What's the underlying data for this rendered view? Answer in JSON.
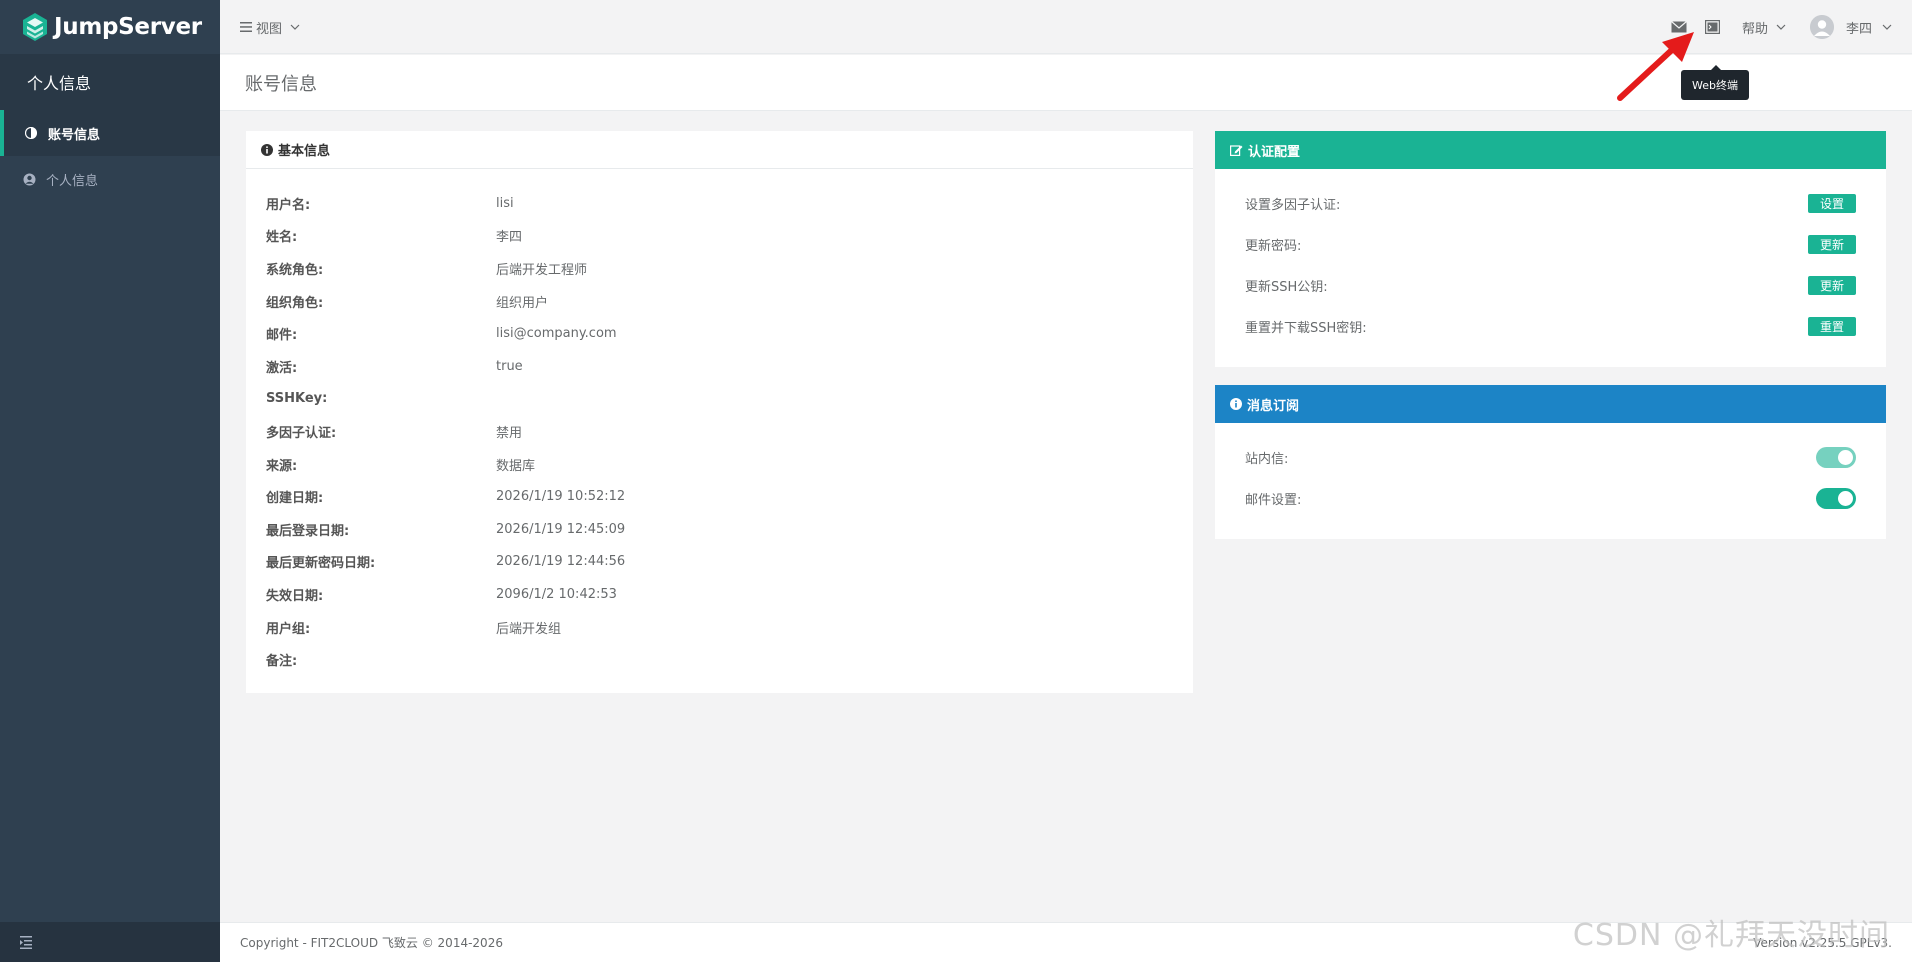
{
  "brand": {
    "name": "JumpServer"
  },
  "sidebar": {
    "header": "个人信息",
    "items": [
      {
        "label": "账号信息",
        "icon": "half-circle-icon",
        "active": true
      },
      {
        "label": "个人信息",
        "icon": "user-circle-icon",
        "active": false
      }
    ]
  },
  "topbar": {
    "view_menu": "视图",
    "help": "帮助",
    "user": "李四",
    "tooltip": "Web终端"
  },
  "page": {
    "title": "账号信息"
  },
  "basic_info": {
    "title": "基本信息",
    "rows": [
      {
        "label": "用户名:",
        "value": "lisi"
      },
      {
        "label": "姓名:",
        "value": "李四"
      },
      {
        "label": "系统角色:",
        "value": "后端开发工程师"
      },
      {
        "label": "组织角色:",
        "value": "组织用户"
      },
      {
        "label": "邮件:",
        "value": "lisi@company.com"
      },
      {
        "label": "激活:",
        "value": "true"
      },
      {
        "label": "SSHKey:",
        "value": ""
      },
      {
        "label": "多因子认证:",
        "value": "禁用"
      },
      {
        "label": "来源:",
        "value": "数据库"
      },
      {
        "label": "创建日期:",
        "value": "2026/1/19 10:52:12"
      },
      {
        "label": "最后登录日期:",
        "value": "2026/1/19 12:45:09"
      },
      {
        "label": "最后更新密码日期:",
        "value": "2026/1/19 12:44:56"
      },
      {
        "label": "失效日期:",
        "value": "2096/1/2 10:42:53"
      },
      {
        "label": "用户组:",
        "value": "后端开发组"
      },
      {
        "label": "备注:",
        "value": ""
      }
    ]
  },
  "auth_config": {
    "title": "认证配置",
    "items": [
      {
        "label": "设置多因子认证:",
        "button": "设置"
      },
      {
        "label": "更新密码:",
        "button": "更新"
      },
      {
        "label": "更新SSH公钥:",
        "button": "更新"
      },
      {
        "label": "重置并下载SSH密钥:",
        "button": "重置"
      }
    ]
  },
  "subscription": {
    "title": "消息订阅",
    "items": [
      {
        "label": "站内信:",
        "enabled": true
      },
      {
        "label": "邮件设置:",
        "enabled": true
      }
    ]
  },
  "footer": {
    "copyright": "Copyright - FIT2CLOUD 飞致云 © 2014-2026",
    "version": "Version v2.25.5 GPLv3."
  },
  "watermark": "CSDN @礼拜天没时间",
  "colors": {
    "sidebar": "#2f4050",
    "primary": "#1ab394",
    "info": "#1c84c6"
  }
}
